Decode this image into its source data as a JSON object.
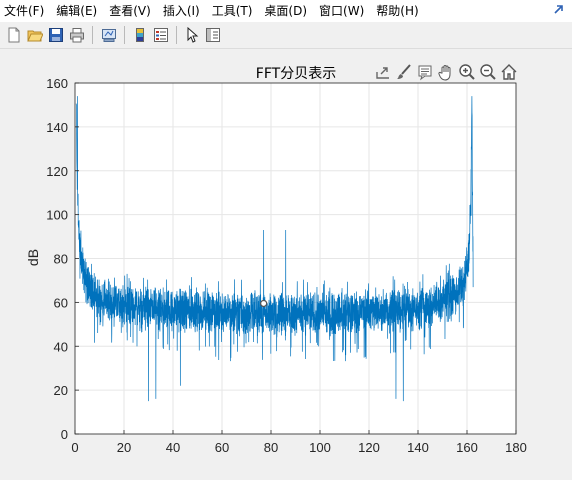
{
  "menu": {
    "items": [
      {
        "label": "文件(F)"
      },
      {
        "label": "编辑(E)"
      },
      {
        "label": "查看(V)"
      },
      {
        "label": "插入(I)"
      },
      {
        "label": "工具(T)"
      },
      {
        "label": "桌面(D)"
      },
      {
        "label": "窗口(W)"
      },
      {
        "label": "帮助(H)"
      }
    ],
    "pin_icon": "dock-arrow-icon"
  },
  "toolbar": {
    "icons": [
      "new-figure-icon",
      "open-file-icon",
      "save-icon",
      "print-icon",
      "link-plot-icon",
      "insert-colorbar-icon",
      "insert-legend-icon",
      "edit-plot-arrow-icon",
      "property-inspector-icon"
    ]
  },
  "axes_toolbar": {
    "icons": [
      "export-icon",
      "brush-icon",
      "data-tips-icon",
      "pan-hand-icon",
      "zoom-in-icon",
      "zoom-out-icon",
      "home-icon"
    ]
  },
  "colors": {
    "line": "#0072bd",
    "grid": "#e6e6e6",
    "axis": "#262626"
  },
  "chart_data": {
    "type": "line",
    "title": "FFT分贝表示",
    "xlabel": "",
    "ylabel": "dB",
    "xlim": [
      0,
      180
    ],
    "ylim": [
      0,
      160
    ],
    "xticks": [
      "0",
      "20",
      "40",
      "60",
      "80",
      "100",
      "120",
      "140",
      "160",
      "180"
    ],
    "yticks": [
      "0",
      "20",
      "40",
      "60",
      "80",
      "100",
      "120",
      "140",
      "160"
    ],
    "grid": true,
    "series": [
      {
        "envelope": {
          "x": [
            0.5,
            1,
            1.5,
            2,
            3,
            4,
            6,
            8,
            10,
            15,
            20,
            30,
            40,
            50,
            60,
            70,
            80,
            90,
            100,
            110,
            120,
            130,
            140,
            145,
            150,
            153,
            155,
            157,
            158,
            159,
            160,
            160.5,
            161,
            161.5,
            162,
            162.5
          ],
          "y": [
            150,
            110,
            92,
            84,
            76,
            71,
            67,
            63,
            61,
            59,
            58,
            57,
            56,
            56,
            55,
            55,
            55,
            55,
            55,
            55,
            56,
            56,
            57,
            58,
            60,
            62,
            64,
            66,
            68,
            70,
            74,
            80,
            88,
            100,
            150,
            70
          ]
        },
        "noise_band_db": [
          45,
          70
        ],
        "spikes": [
          {
            "x": 77,
            "y": 93
          },
          {
            "x": 86,
            "y": 93
          },
          {
            "x": 1,
            "y": 154
          },
          {
            "x": 162,
            "y": 154
          }
        ],
        "deep_dips": [
          {
            "x": 30,
            "y": 15
          },
          {
            "x": 33,
            "y": 16
          },
          {
            "x": 43,
            "y": 22
          },
          {
            "x": 131,
            "y": 16
          },
          {
            "x": 134,
            "y": 15
          }
        ]
      }
    ],
    "marker": {
      "x": 77,
      "y": 59.5
    }
  }
}
